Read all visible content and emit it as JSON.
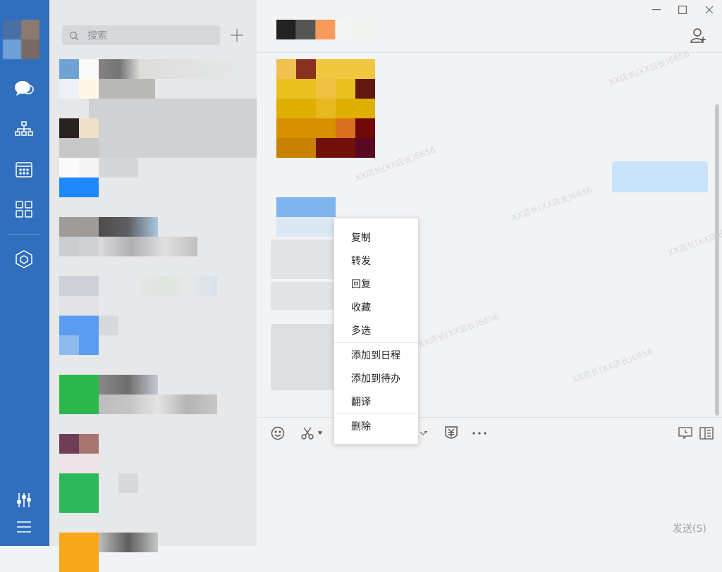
{
  "search": {
    "placeholder": "搜索"
  },
  "context_menu": {
    "items": [
      {
        "label": "复制"
      },
      {
        "label": "转发"
      },
      {
        "label": "回复"
      },
      {
        "label": "收藏"
      },
      {
        "label": "多选"
      },
      {
        "label": "添加到日程"
      },
      {
        "label": "添加到待办"
      },
      {
        "label": "翻译"
      },
      {
        "label": "删除"
      }
    ]
  },
  "send_button": {
    "label": "发送(S)"
  },
  "watermark": {
    "text": "XX店长(XX店长)6656"
  },
  "colors": {
    "rail": "#2f6fbd",
    "list_bg": "#e7e8ea",
    "chat_bg": "#f2f3f5"
  },
  "rail": {
    "icons": [
      "chat-bubbles-icon",
      "org-chart-icon",
      "calendar-icon",
      "apps-grid-icon",
      "cube-icon",
      "settings-sliders-icon",
      "menu-icon"
    ]
  },
  "toolbar": {
    "icons": [
      "emoji-icon",
      "scissors-icon",
      "red-packet-icon",
      "more-icon",
      "history-icon",
      "sidebar-panel-icon"
    ]
  }
}
